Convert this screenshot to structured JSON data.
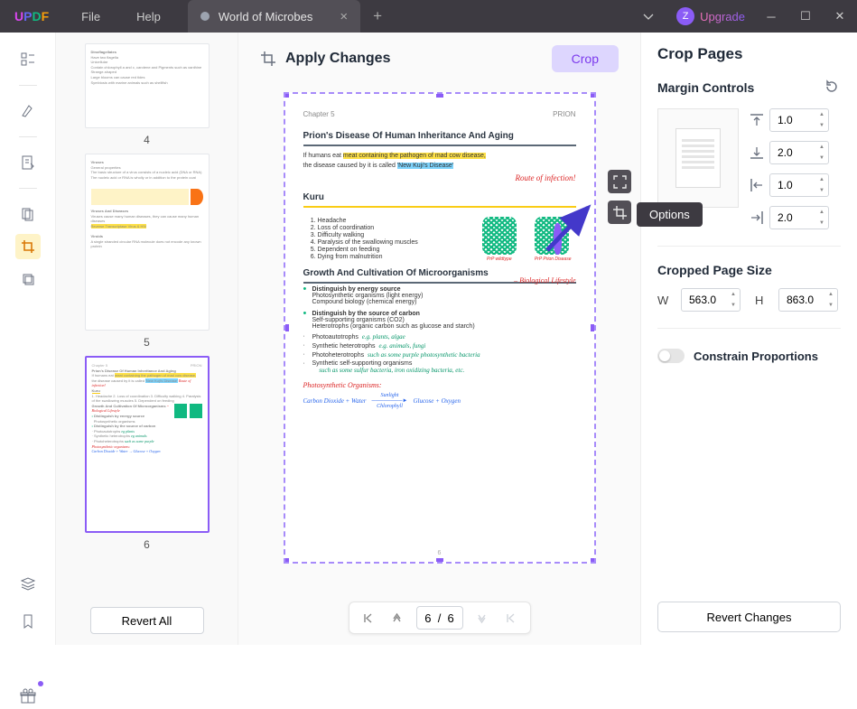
{
  "titlebar": {
    "logo": {
      "u": "U",
      "p": "P",
      "d": "D",
      "f": "F"
    },
    "menu": {
      "file": "File",
      "help": "Help"
    },
    "tab_title": "World of Microbes",
    "avatar_letter": "Z",
    "upgrade": "Upgrade"
  },
  "thumbs": {
    "n4": "4",
    "n5": "5",
    "n6": "6",
    "revert_all": "Revert All",
    "t5_title1": "Viruses",
    "t5_title2": "Viruses And Diseases",
    "t5_title3": "Viroids"
  },
  "center": {
    "apply_changes": "Apply Changes",
    "crop": "Crop",
    "tooltip": "Options",
    "pager_value": "6  /  6"
  },
  "page": {
    "chapter": "Chapter 5",
    "prion_label": "PRION",
    "h1": "Prion's Disease Of Human Inheritance And Aging",
    "p1a": "If humans eat ",
    "p1_hy": "meat containing the pathogen of mad cow disease,",
    "p2a": "the disease caused by it is called ",
    "p2_hb": "'New Kuji's Disease'",
    "route": "Route of infection!",
    "kuru": "Kuru",
    "kuru_items": [
      "Headache",
      "Loss of coordination",
      "Difficulty walking",
      "Paralysis of the swallowing muscles",
      "Dependent on feeding",
      "Dying from malnutrition"
    ],
    "prp_a": "PrP wildtype",
    "prp_b": "PrP Prion Disease",
    "growth": "Growth And Cultivation Of Microorganisms",
    "lifestyle": "– Biological Lifestyle",
    "energy": "Distinguish by energy source",
    "energy_l1": "Photosynthetic organisms (light energy)",
    "energy_l2": "Compound biology (chemical energy)",
    "carbon": "Distinguish by the source of carbon",
    "carbon_l1": "Self-supporting organisms (CO2)",
    "carbon_l2": "Heterotrophs (organic carbon such as glucose and starch)",
    "b1": "Photoautotrophs",
    "b1h": "e.g. plants, algae",
    "b2": "Synthetic heterotrophs",
    "b2h": "e.g. animals, fungi",
    "b3": "Photoheterotrophs",
    "b3h": "such as some purple photosynthetic bacteria",
    "b4": "Synthetic self-supporting organisms",
    "b4h": "such as some sulfur bacteria, iron oxidizing bacteria, etc.",
    "photo_org": "Photosynthetic Organisms:",
    "eq_l": "Carbon Dioxide + Water",
    "eq_top": "Sunlight",
    "eq_bot": "Chlorophyll",
    "eq_r": "Glucose + Oxygen",
    "page_num": "6"
  },
  "right": {
    "title": "Crop Pages",
    "margin_controls": "Margin Controls",
    "m_top": "1.0",
    "m_bottom": "2.0",
    "m_left": "1.0",
    "m_right": "2.0",
    "cps_title": "Cropped Page Size",
    "w_label": "W",
    "w_val": "563.0",
    "h_label": "H",
    "h_val": "863.0",
    "constrain": "Constrain Proportions",
    "revert_changes": "Revert Changes"
  }
}
